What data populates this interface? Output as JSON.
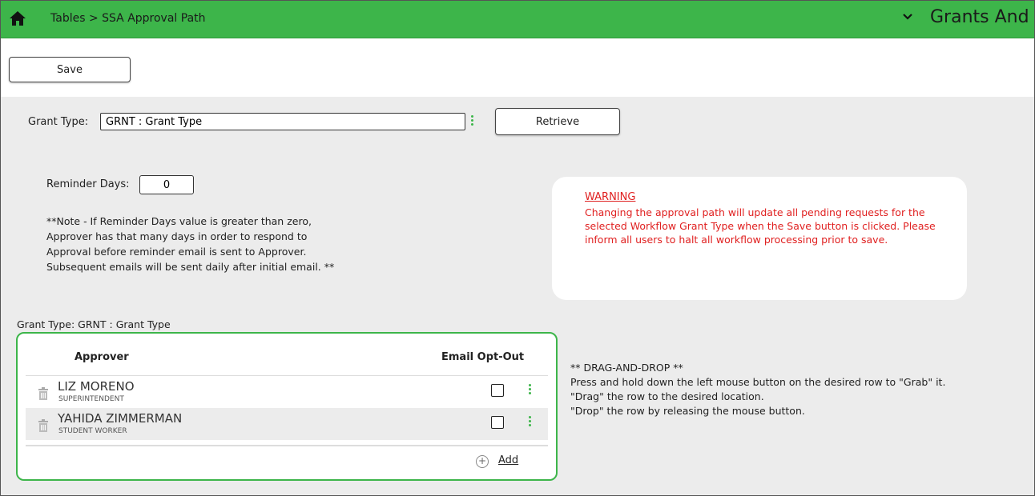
{
  "header": {
    "breadcrumb": "Tables > SSA Approval Path",
    "app_title": "Grants And Projects",
    "icons": {
      "home": "home-icon",
      "expand": "chevron-down-icon"
    },
    "accent_color": "#3db54a"
  },
  "toolbar": {
    "save_label": "Save"
  },
  "filter": {
    "grant_type_label": "Grant Type:",
    "grant_type_value": "GRNT : Grant Type",
    "retrieve_label": "Retrieve"
  },
  "reminder": {
    "label": "Reminder Days:",
    "value": "0",
    "note_lines": [
      "**Note - If Reminder Days value is greater than zero,",
      "Approver has that many days in order to respond to",
      "Approval before reminder email is sent to Approver.",
      "Subsequent emails will be sent daily after initial email. **"
    ]
  },
  "warning": {
    "title": "WARNING",
    "text": "Changing the approval path will update all pending requests for the selected Workflow Grant Type when the Save button is clicked. Please inform all users to halt all workflow processing prior to save.",
    "color": "#e02020"
  },
  "approvers": {
    "caption": "Grant Type: GRNT : Grant Type",
    "col_approver": "Approver",
    "col_email": "Email Opt-Out",
    "rows": [
      {
        "name": "LIZ MORENO",
        "role": "SUPERINTENDENT",
        "opt_out": false
      },
      {
        "name": "YAHIDA ZIMMERMAN",
        "role": "STUDENT WORKER",
        "opt_out": false
      }
    ],
    "add_label": "Add"
  },
  "dnd": {
    "title": "** DRAG-AND-DROP **",
    "lines": [
      "Press and hold down the left mouse button on the desired row to \"Grab\" it.",
      "\"Drag\" the row to the desired location.",
      "\"Drop\" the row by releasing the mouse button."
    ]
  }
}
